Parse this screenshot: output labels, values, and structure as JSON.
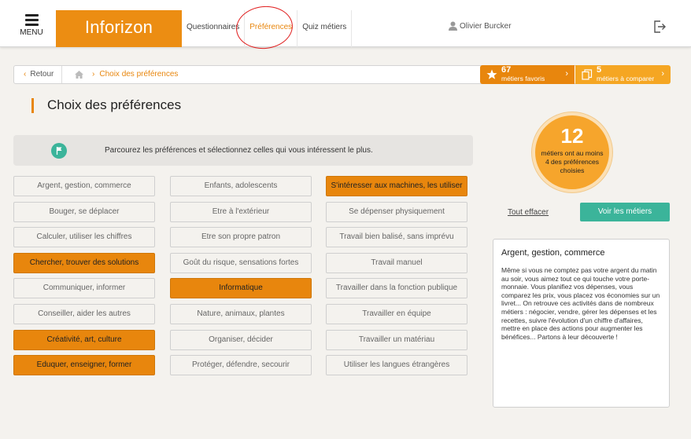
{
  "header": {
    "menu_label": "MENU",
    "logo_text": "Inforizon",
    "nav": [
      {
        "label": "Questionnaires",
        "active": false
      },
      {
        "label": "Préférences",
        "active": true
      },
      {
        "label": "Quiz métiers",
        "active": false
      }
    ],
    "user_name": "Olivier Burcker",
    "accent": "#ec8d12"
  },
  "breadcrumb": {
    "back_label": "Retour",
    "current": "Choix des préférences"
  },
  "favorites": {
    "count": "67",
    "label": "métiers favoris"
  },
  "compare": {
    "count": "5",
    "label": "métiers à comparer"
  },
  "page_title": "Choix des préférences",
  "info_text": "Parcourez les préférences et sélectionnez celles qui vous intéressent le plus.",
  "preferences": {
    "col1": [
      {
        "label": "Argent, gestion, commerce",
        "selected": false
      },
      {
        "label": "Bouger, se déplacer",
        "selected": false
      },
      {
        "label": "Calculer, utiliser les chiffres",
        "selected": false
      },
      {
        "label": "Chercher, trouver des solutions",
        "selected": true
      },
      {
        "label": "Communiquer, informer",
        "selected": false
      },
      {
        "label": "Conseiller, aider les autres",
        "selected": false
      },
      {
        "label": "Créativité, art, culture",
        "selected": true
      },
      {
        "label": "Eduquer, enseigner, former",
        "selected": true
      }
    ],
    "col2": [
      {
        "label": "Enfants, adolescents",
        "selected": false
      },
      {
        "label": "Etre à l'extérieur",
        "selected": false
      },
      {
        "label": "Etre son propre patron",
        "selected": false
      },
      {
        "label": "Goût du risque, sensations fortes",
        "selected": false
      },
      {
        "label": "Informatique",
        "selected": true
      },
      {
        "label": "Nature, animaux, plantes",
        "selected": false
      },
      {
        "label": "Organiser, décider",
        "selected": false
      },
      {
        "label": "Protéger, défendre, secourir",
        "selected": false
      }
    ],
    "col3": [
      {
        "label": "S'intéresser aux machines, les utiliser",
        "selected": true
      },
      {
        "label": "Se dépenser physiquement",
        "selected": false
      },
      {
        "label": "Travail bien balisé, sans imprévu",
        "selected": false
      },
      {
        "label": "Travail manuel",
        "selected": false
      },
      {
        "label": "Travailler dans la fonction publique",
        "selected": false
      },
      {
        "label": "Travailler en équipe",
        "selected": false
      },
      {
        "label": "Travailler un matériau",
        "selected": false
      },
      {
        "label": "Utiliser les langues étrangères",
        "selected": false
      }
    ]
  },
  "counter": {
    "number": "12",
    "line1": "métiers ont au moins",
    "line2": "4 des préférences choisies"
  },
  "clear_all_label": "Tout effacer",
  "see_jobs_label": "Voir les métiers",
  "description": {
    "title": "Argent, gestion, commerce",
    "body": "Même si vous ne comptez pas votre argent du matin au soir, vous aimez tout ce qui touche votre porte-monnaie. Vous planifiez vos dépenses, vous comparez les prix, vous placez vos économies sur un livret... On retrouve ces activités dans de nombreux métiers : négocier, vendre, gérer les dépenses et les recettes, suivre l'évolution d'un chiffre d'affaires, mettre en place des actions pour augmenter les bénéfices... Partons à leur découverte !"
  },
  "colors": {
    "orange": "#e8860d",
    "light_orange": "#f5a623",
    "teal": "#3bb49a"
  }
}
